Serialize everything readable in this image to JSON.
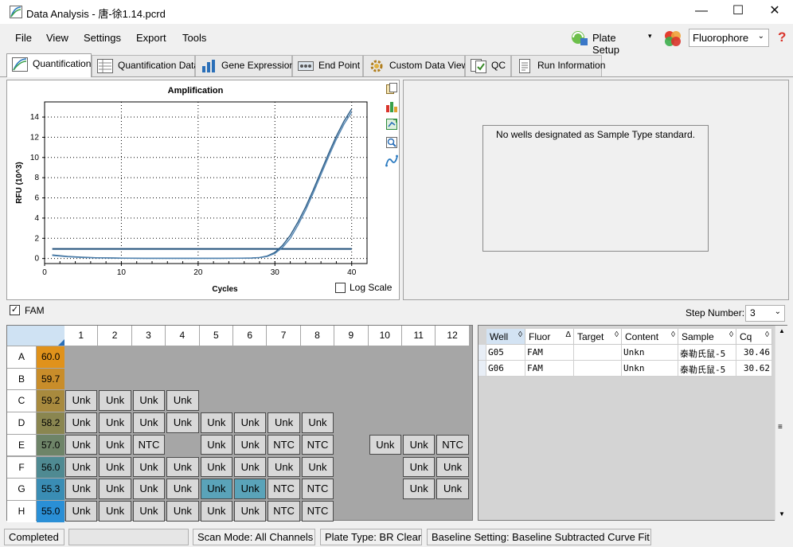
{
  "window": {
    "title": "Data Analysis - 唐-徐1.14.pcrd",
    "controls": {
      "minimize": "—",
      "maximize": "☐",
      "close": "✕"
    }
  },
  "menu": [
    "File",
    "View",
    "Settings",
    "Export",
    "Tools"
  ],
  "toolbar": {
    "plate_setup": "Plate Setup",
    "fluorophore": "Fluorophore",
    "help": "?"
  },
  "tabs": [
    "Quantification",
    "Quantification Data",
    "Gene Expression",
    "End Point",
    "Custom Data View",
    "QC",
    "Run Information"
  ],
  "chart_data": {
    "type": "line",
    "title": "Amplification",
    "xlabel": "Cycles",
    "ylabel": "RFU (10^3)",
    "xlim": [
      0,
      42
    ],
    "ylim": [
      -0.5,
      15.5
    ],
    "xticks": [
      0,
      10,
      20,
      30,
      40
    ],
    "yticks": [
      0,
      2,
      4,
      6,
      8,
      10,
      12,
      14
    ],
    "grid": true,
    "threshold": 0.95,
    "series": [
      {
        "x": [
          1,
          3,
          5,
          7,
          9,
          11,
          13,
          15,
          17,
          19,
          21,
          23,
          25,
          27,
          28,
          29,
          30,
          31,
          32,
          33,
          34,
          35,
          36,
          37,
          38,
          39,
          40
        ],
        "values": [
          0.35,
          0.2,
          0.12,
          0.07,
          0.05,
          0.03,
          0.02,
          0.02,
          0.02,
          0.02,
          0.02,
          0.02,
          0.03,
          0.05,
          0.1,
          0.25,
          0.6,
          1.3,
          2.3,
          3.6,
          5.1,
          6.8,
          8.6,
          10.4,
          12.1,
          13.6,
          14.8
        ]
      },
      {
        "x": [
          1,
          3,
          5,
          7,
          9,
          11,
          13,
          15,
          17,
          19,
          21,
          23,
          25,
          27,
          28,
          29,
          30,
          31,
          32,
          33,
          34,
          35,
          36,
          37,
          38,
          39,
          40
        ],
        "values": [
          0.3,
          0.18,
          0.1,
          0.06,
          0.04,
          0.03,
          0.02,
          0.02,
          0.02,
          0.02,
          0.02,
          0.02,
          0.03,
          0.04,
          0.08,
          0.2,
          0.5,
          1.1,
          2.0,
          3.3,
          4.8,
          6.5,
          8.3,
          10.1,
          11.8,
          13.3,
          14.5
        ]
      }
    ]
  },
  "log_scale_label": "Log Scale",
  "std_message": "No wells designated as Sample Type standard.",
  "fam_label": "FAM",
  "step": {
    "label": "Step Number:",
    "value": "3"
  },
  "plate": {
    "cols": [
      "1",
      "2",
      "3",
      "4",
      "5",
      "6",
      "7",
      "8",
      "9",
      "10",
      "11",
      "12"
    ],
    "rows": [
      {
        "label": "A",
        "temp": "60.0",
        "color": "#e0921b",
        "wells": [
          "",
          "",
          "",
          "",
          "",
          "",
          "",
          "",
          "",
          "",
          "",
          ""
        ]
      },
      {
        "label": "B",
        "temp": "59.7",
        "color": "#c98d2a",
        "wells": [
          "",
          "",
          "",
          "",
          "",
          "",
          "",
          "",
          "",
          "",
          "",
          ""
        ]
      },
      {
        "label": "C",
        "temp": "59.2",
        "color": "#a88a3e",
        "wells": [
          "Unk",
          "Unk",
          "Unk",
          "Unk",
          "",
          "",
          "",
          "",
          "",
          "",
          "",
          ""
        ]
      },
      {
        "label": "D",
        "temp": "58.2",
        "color": "#8a8650",
        "wells": [
          "Unk",
          "Unk",
          "Unk",
          "Unk",
          "Unk",
          "Unk",
          "Unk",
          "Unk",
          "",
          "",
          "",
          ""
        ]
      },
      {
        "label": "E",
        "temp": "57.0",
        "color": "#6e8468",
        "wells": [
          "Unk",
          "Unk",
          "NTC",
          "",
          "Unk",
          "Unk",
          "NTC",
          "NTC",
          "",
          "Unk",
          "Unk",
          "NTC"
        ]
      },
      {
        "label": "F",
        "temp": "56.0",
        "color": "#4f8a92",
        "wells": [
          "Unk",
          "Unk",
          "Unk",
          "Unk",
          "Unk",
          "Unk",
          "Unk",
          "Unk",
          "",
          "",
          "Unk",
          "Unk"
        ]
      },
      {
        "label": "G",
        "temp": "55.3",
        "color": "#3a8db4",
        "wells": [
          "Unk",
          "Unk",
          "Unk",
          "Unk",
          "Unk",
          "Unk",
          "NTC",
          "NTC",
          "",
          "",
          "Unk",
          "Unk"
        ]
      },
      {
        "label": "H",
        "temp": "55.0",
        "color": "#2a8fd6",
        "wells": [
          "Unk",
          "Unk",
          "Unk",
          "Unk",
          "Unk",
          "Unk",
          "NTC",
          "NTC",
          "",
          "",
          "",
          ""
        ]
      }
    ],
    "selected": [
      "G5",
      "G6"
    ]
  },
  "table": {
    "headers": [
      "Well",
      "Fluor",
      "Target",
      "Content",
      "Sample",
      "Cq"
    ],
    "rows": [
      [
        "G05",
        "FAM",
        "",
        "Unkn",
        "泰勒氏鼠-5",
        "30.46"
      ],
      [
        "G06",
        "FAM",
        "",
        "Unkn",
        "泰勒氏鼠-5",
        "30.62"
      ]
    ]
  },
  "status": [
    "Completed",
    "",
    "Scan Mode: All Channels",
    "Plate Type: BR Clear",
    "Baseline Setting: Baseline Subtracted Curve Fit"
  ]
}
